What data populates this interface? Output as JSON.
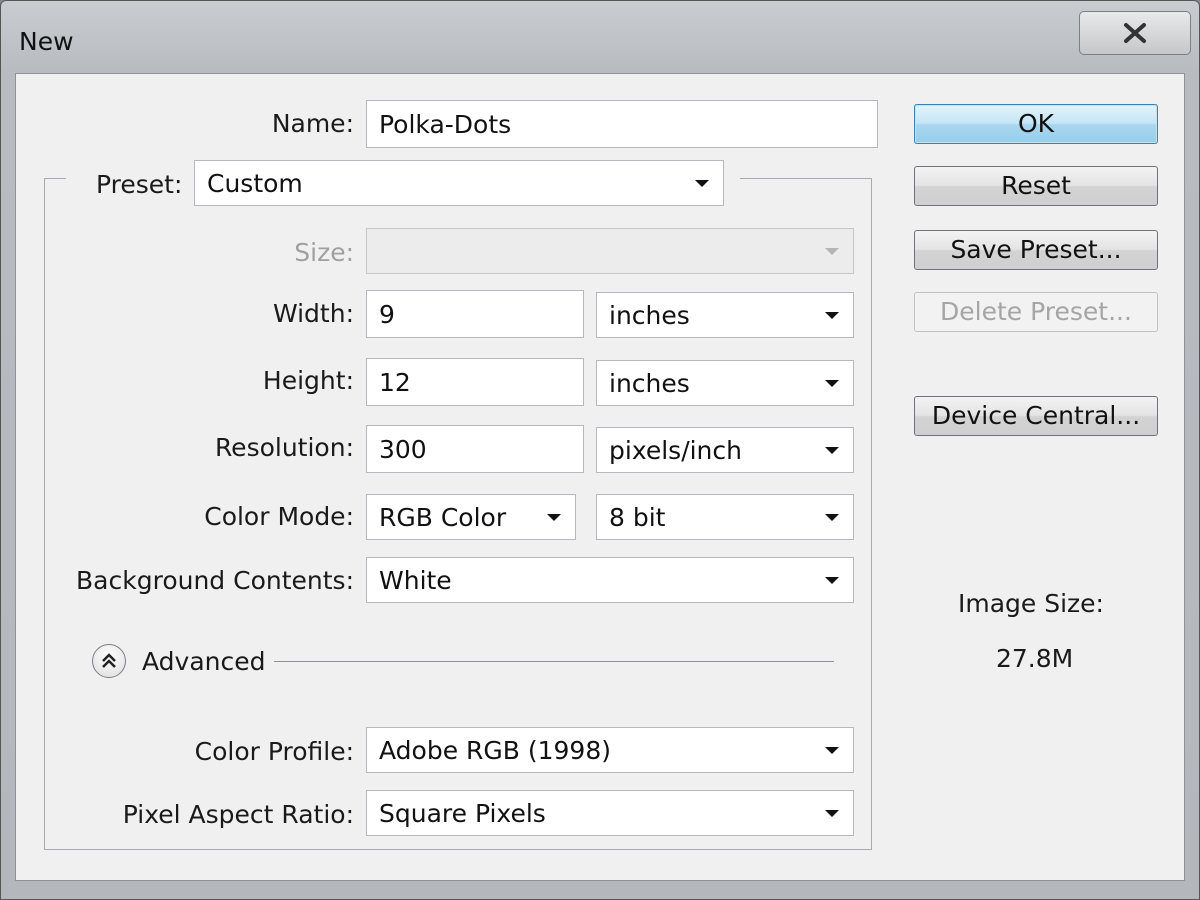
{
  "window": {
    "title": "New",
    "close_icon": "close-x-icon"
  },
  "form": {
    "name_label": "Name:",
    "name_value": "Polka-Dots",
    "preset_label": "Preset:",
    "preset_value": "Custom",
    "size_label": "Size:",
    "size_value": "",
    "width_label": "Width:",
    "width_value": "9",
    "width_unit": "inches",
    "height_label": "Height:",
    "height_value": "12",
    "height_unit": "inches",
    "resolution_label": "Resolution:",
    "resolution_value": "300",
    "resolution_unit": "pixels/inch",
    "color_mode_label": "Color Mode:",
    "color_mode_value": "RGB Color",
    "bit_depth_value": "8 bit",
    "background_label": "Background Contents:",
    "background_value": "White",
    "advanced_label": "Advanced",
    "advanced_icon": "chevron-double-up-icon",
    "color_profile_label": "Color Profile:",
    "color_profile_value": "Adobe RGB (1998)",
    "pixel_aspect_label": "Pixel Aspect Ratio:",
    "pixel_aspect_value": "Square Pixels"
  },
  "buttons": {
    "ok": "OK",
    "reset": "Reset",
    "save_preset": "Save Preset...",
    "delete_preset": "Delete Preset...",
    "device_central": "Device Central..."
  },
  "image_size": {
    "label": "Image Size:",
    "value": "27.8M"
  },
  "colors": {
    "default_button": "#a8d7ef",
    "disabled_text": "#a0a0a0",
    "dialog_background": "#f0f0f0"
  }
}
